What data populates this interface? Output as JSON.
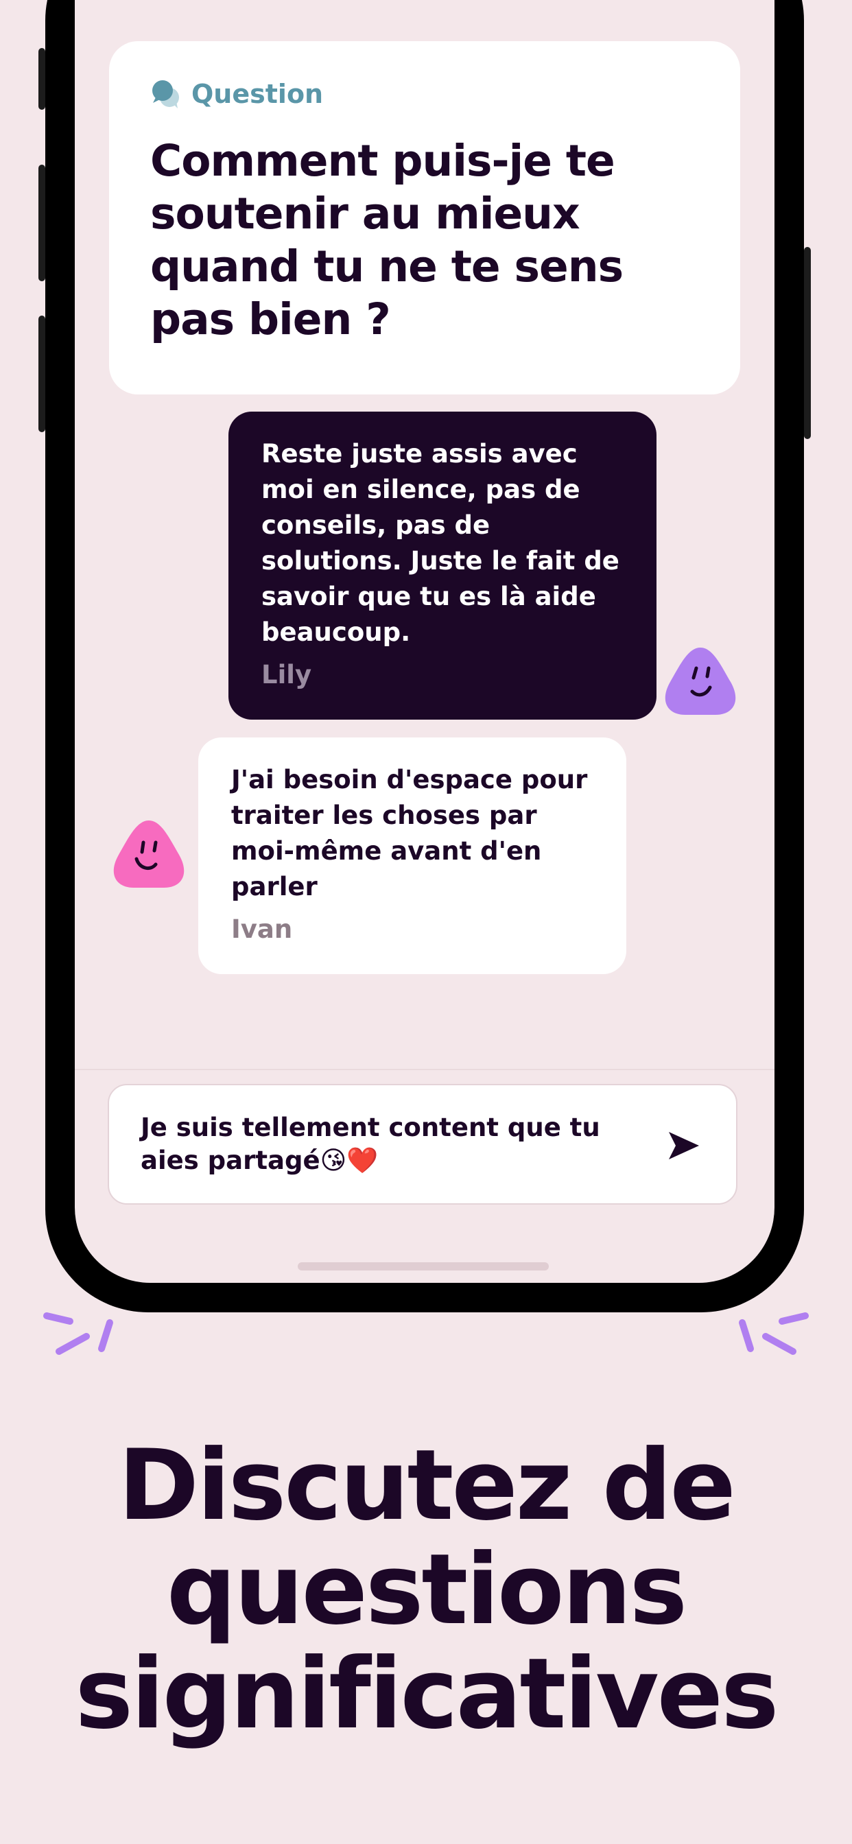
{
  "question_card": {
    "label": "Question",
    "text": "Comment puis-je te soutenir au mieux quand tu ne te sens pas bien ?"
  },
  "messages": [
    {
      "text": "Reste juste assis avec moi en silence, pas de conseils, pas de solutions. Juste le fait de savoir que tu es là aide beaucoup.",
      "author": "Lily",
      "avatar_color": "#b07ff0",
      "bubble_color": "#1c0727"
    },
    {
      "text": "J'ai besoin d'espace pour traiter les choses par moi-même avant d'en parler",
      "author": "Ivan",
      "avatar_color": "#f76bbf",
      "bubble_color": "#ffffff"
    }
  ],
  "composer": {
    "value": "Je suis tellement content que tu aies partagé😘❤️"
  },
  "headline": "Discutez de questions significatives",
  "colors": {
    "background": "#f4e7ea",
    "ink": "#1c0727",
    "accent_teal": "#5a96a8",
    "sparkle": "#b07ff0"
  },
  "icons": [
    "chat-bubbles-icon",
    "send-icon",
    "smiley-avatar-icon"
  ]
}
